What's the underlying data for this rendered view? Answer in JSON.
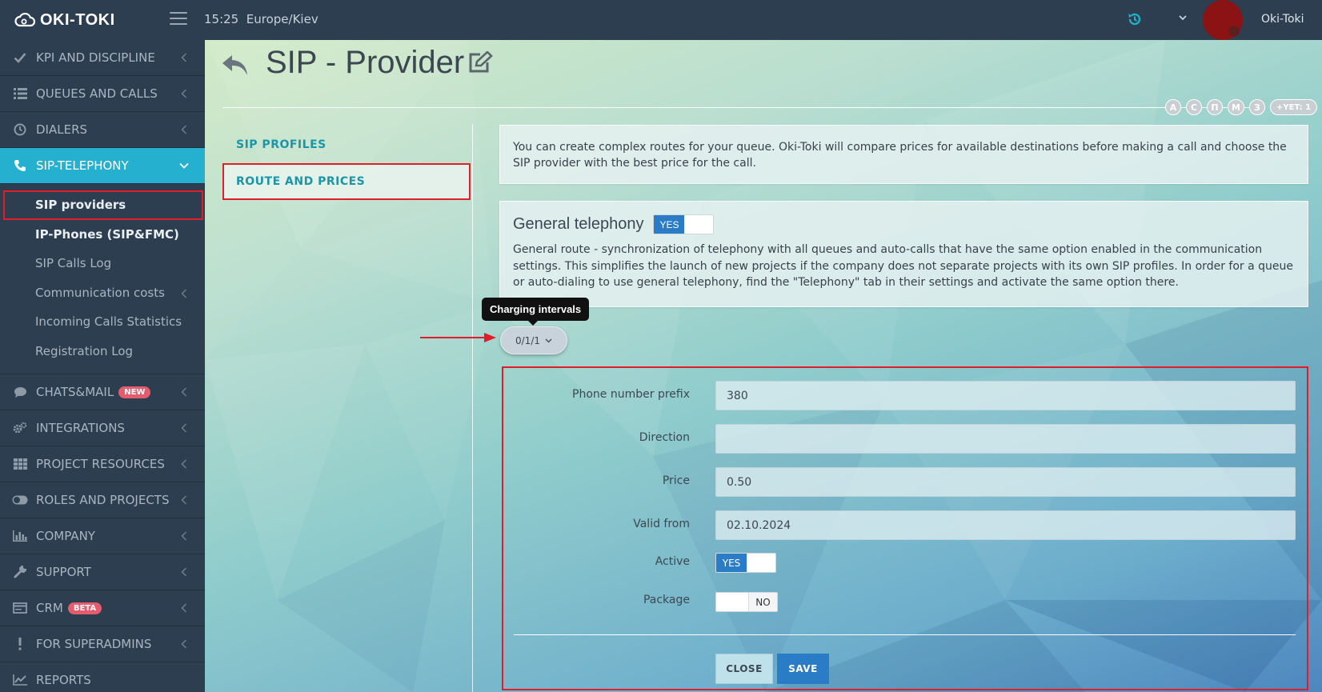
{
  "header": {
    "logo_text": "OKI-TOKI",
    "time": "15:25",
    "timezone": "Europe/Kiev",
    "username": "Oki-Toki"
  },
  "sidebar": {
    "items": [
      {
        "label": "KPI AND DISCIPLINE",
        "icon": "check-icon"
      },
      {
        "label": "QUEUES AND CALLS",
        "icon": "list-icon"
      },
      {
        "label": "DIALERS",
        "icon": "clock-icon"
      },
      {
        "label": "SIP-TELEPHONY",
        "icon": "phone-icon"
      },
      {
        "label": "CHATS&MAIL",
        "icon": "chat-icon",
        "badge": "NEW"
      },
      {
        "label": "INTEGRATIONS",
        "icon": "gears-icon"
      },
      {
        "label": "PROJECT RESOURCES",
        "icon": "grid-icon"
      },
      {
        "label": "ROLES AND PROJECTS",
        "icon": "toggle-icon"
      },
      {
        "label": "COMPANY",
        "icon": "bar-chart-icon"
      },
      {
        "label": "SUPPORT",
        "icon": "wrench-icon"
      },
      {
        "label": "CRM",
        "icon": "card-icon",
        "badge": "BETA"
      },
      {
        "label": "FOR SUPERADMINS",
        "icon": "exclamation-icon"
      },
      {
        "label": "REPORTS",
        "icon": "line-chart-icon"
      }
    ],
    "submenu": [
      {
        "label": "SIP providers"
      },
      {
        "label": "IP-Phones (SIP&FMC)"
      },
      {
        "label": "SIP Calls Log"
      },
      {
        "label": "Communication costs"
      },
      {
        "label": "Incoming Calls Statistics"
      },
      {
        "label": "Registration Log"
      }
    ]
  },
  "page": {
    "title": "SIP - Provider",
    "chips": [
      "А",
      "С",
      "П",
      "М",
      "З",
      "+YET: 1"
    ],
    "tabs": [
      {
        "label": "SIP PROFILES"
      },
      {
        "label": "ROUTE AND PRICES"
      }
    ],
    "info_text": "You can create complex routes for your queue. Oki-Toki will compare prices for available destinations before making a call and choose the SIP provider with the best price for the call.",
    "general": {
      "title": "General telephony",
      "toggle_label": "YES",
      "text": "General route - synchronization of telephony with all queues and auto-calls that have the same option enabled in the communication settings. This simplifies the launch of new projects if the company does not separate projects with its own SIP profiles. In order for a queue or auto-dialing to use general telephony, find the \"Telephony\" tab in their settings and activate the same option there."
    },
    "tooltip": "Charging intervals",
    "intervals_value": "0/1/1"
  },
  "form": {
    "prefix_label": "Phone number prefix",
    "prefix_value": "380",
    "direction_label": "Direction",
    "direction_value": "",
    "price_label": "Price",
    "price_value": "0.50",
    "valid_from_label": "Valid from",
    "valid_from_value": "02.10.2024",
    "active_label": "Active",
    "active_toggle": "YES",
    "package_label": "Package",
    "package_toggle": "NO",
    "close_label": "CLOSE",
    "save_label": "SAVE"
  },
  "colors": {
    "sidebar_bg": "#2c3e50",
    "active_item": "#25b0d0",
    "accent_blue": "#2b7cc7",
    "highlight_red": "#e11d2a",
    "tab_text": "#1c95a8"
  }
}
